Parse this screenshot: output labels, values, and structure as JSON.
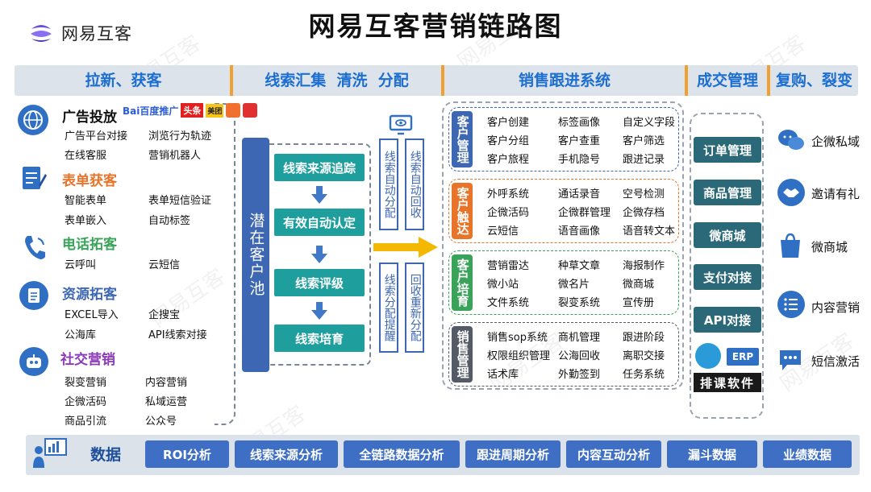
{
  "brand": {
    "name": "网易互客"
  },
  "title": "网易互客营销链路图",
  "headers": [
    "拉新、获客",
    "线索汇集  清洗  分配",
    "销售跟进系统",
    "成交管理",
    "复购、裂变"
  ],
  "acquire": {
    "ads": {
      "title": "广告投放",
      "platforms": [
        "Bai百度推广",
        "头条",
        "美团"
      ],
      "items": [
        "广告平台对接",
        "浏览行为轨迹",
        "在线客服",
        "营销机器人"
      ]
    },
    "form": {
      "title": "表单获客",
      "items": [
        "智能表单",
        "表单短信验证",
        "表单嵌入",
        "自动标签"
      ]
    },
    "phone": {
      "title": "电话拓客",
      "items": [
        "云呼叫",
        "云短信"
      ]
    },
    "resource": {
      "title": "资源拓客",
      "items": [
        "EXCEL导入",
        "企搜宝",
        "公海库",
        "API线索对接"
      ]
    },
    "social": {
      "title": "社交营销",
      "items": [
        "裂变营销",
        "内容营销",
        "企微活码",
        "私域运营",
        "商品引流",
        "公众号"
      ]
    }
  },
  "leads": {
    "pool": "潜在客户池",
    "steps": [
      "线索来源追踪",
      "有效自动认定",
      "线索评级",
      "线索培育"
    ],
    "side": [
      "线索自动分配",
      "线索自动回收",
      "线索分配提醒",
      "回收重新分配"
    ]
  },
  "sales": {
    "groups": [
      {
        "label": "客户管理",
        "color": "#3d67b3",
        "items": [
          "客户创建",
          "标签画像",
          "自定义字段",
          "客户分组",
          "客户查重",
          "客户筛选",
          "客户旅程",
          "手机隐号",
          "跟进记录"
        ]
      },
      {
        "label": "客户触达",
        "color": "#e8742a",
        "items": [
          "外呼系统",
          "通话录音",
          "空号检测",
          "企微活码",
          "企微群管理",
          "企微存档",
          "云短信",
          "语音画像",
          "语音转文本"
        ]
      },
      {
        "label": "客户培育",
        "color": "#3aa35a",
        "items": [
          "营销雷达",
          "种草文章",
          "海报制作",
          "微小站",
          "微名片",
          "微商城",
          "文件系统",
          "裂变系统",
          "宣传册"
        ]
      },
      {
        "label": "销售管理",
        "color": "#555b66",
        "items": [
          "销售sop系统",
          "商机管理",
          "跟进阶段",
          "权限组织管理",
          "公海回收",
          "离职交接",
          "话术库",
          "外勤签到",
          "任务系统"
        ]
      }
    ]
  },
  "deal": {
    "items": [
      "订单管理",
      "商品管理",
      "微商城",
      "支付对接",
      "API对接"
    ],
    "partner": "排课软件",
    "erp": "ERP"
  },
  "repurchase": {
    "items": [
      "企微私域",
      "邀请有礼",
      "微商城",
      "内容营销",
      "短信激活"
    ]
  },
  "data": {
    "label": "数据",
    "items": [
      "ROI分析",
      "线索来源分析",
      "全链路数据分析",
      "跟进周期分析",
      "内容互动分析",
      "漏斗数据",
      "业绩数据"
    ]
  }
}
